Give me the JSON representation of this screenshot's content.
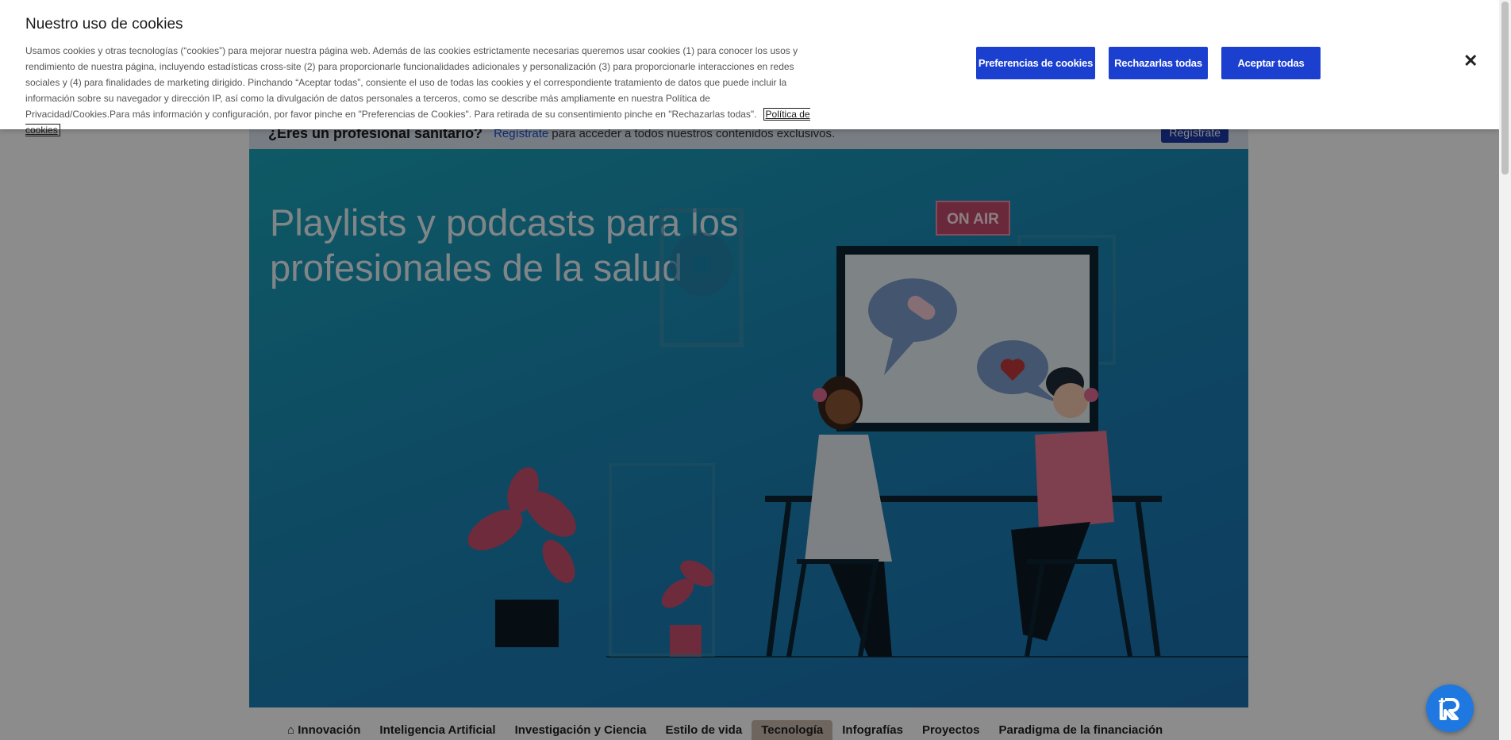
{
  "cookie_banner": {
    "title": "Nuestro uso de cookies",
    "text": "Usamos cookies y otras tecnologías (“cookies”) para mejorar nuestra página web. Además de las cookies estrictamente necesarias queremos usar cookies (1) para conocer los usos y rendimiento de nuestra página, incluyendo estadísticas cross-site (2) para proporcionarle funcionalidades adicionales y personalización (3) para proporcionarle interacciones en redes sociales y (4) para finalidades de marketing dirigido. Pinchando “Aceptar todas”, consiente el uso de todas las cookies y el correspondiente tratamiento de datos que puede incluir la información sobre su navegador y dirección IP, así como la divulgación de datos personales a terceros, como se describe más ampliamente en nuestra Política de Privacidad/Cookies.Para más información y configuración, por favor pinche en \"Preferencias de Cookies\". Para retirada de su consentimiento pinche en \"Rechazarlas todas\".",
    "policy_link": "Política de cookies",
    "btn_preferences": "Preferencias de cookies",
    "btn_reject": "Rechazarlas todas",
    "btn_accept": "Aceptar todas",
    "close_symbol": "✕"
  },
  "pro_bar": {
    "question": "¿Eres un profesional sanitario?",
    "link": "Regístrate",
    "rest": "para acceder a todos nuestros contenidos exclusivos.",
    "button": "Regístrate"
  },
  "hero": {
    "title": "Playlists y podcasts para los profesionales de la salud",
    "sign_text": "ON AIR"
  },
  "nav": {
    "items": [
      "Innovación",
      "Inteligencia Artificial",
      "Investigación y Ciencia",
      "Estilo de vida",
      "Tecnología",
      "Infografías",
      "Proyectos",
      "Paradigma de la financiación"
    ],
    "active_index": 4
  },
  "colors": {
    "primary_button": "#1b3fcf",
    "hero_teal": "#1aa3b8",
    "widget_blue": "#1f78e0"
  },
  "icons": {
    "home": "home-icon",
    "close": "close-icon",
    "widget": "reciteme-widget-icon"
  }
}
